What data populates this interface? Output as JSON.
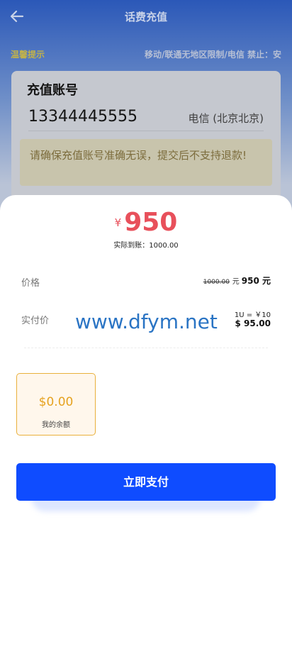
{
  "header": {
    "title": "话费充值",
    "back_icon": "arrow-left-icon"
  },
  "notice": {
    "label": "温馨提示",
    "text": "移动/联通无地区限制/电信 禁止：安"
  },
  "account": {
    "heading": "充值账号",
    "number": "13344445555",
    "carrier": "电信 (北京北京)",
    "warning": "请确保充值账号准确无误，提交后不支持退款!"
  },
  "payment": {
    "currency_symbol": "¥",
    "amount": "950",
    "actual_text": "实际到账：1000.00",
    "price_label": "价格",
    "price_original": "1000.00",
    "price_original_unit": "元",
    "price_now": "950 元",
    "paid_label": "实付价",
    "rate_text": "1U = ￥10",
    "usd_amount": "$ 95.00",
    "watermark": "www.dfym.net",
    "balance_amount": "$0.00",
    "balance_label": "我的余额",
    "pay_button": "立即支付"
  },
  "colors": {
    "accent": "#0f4cff",
    "amount": "#e8505b",
    "balance": "#e6a21f"
  }
}
